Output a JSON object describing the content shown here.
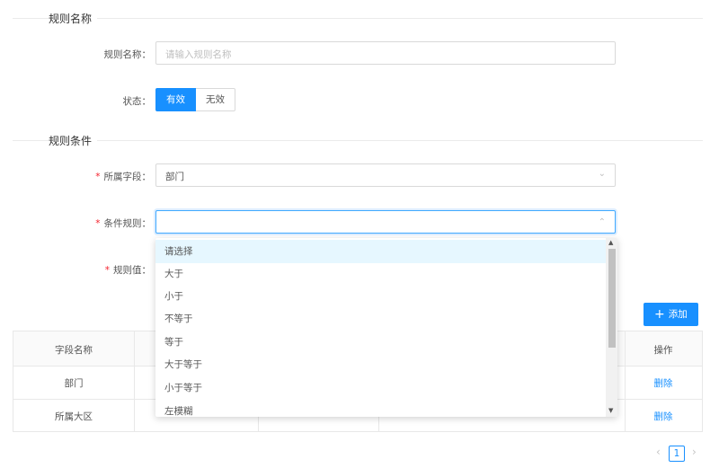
{
  "section_basic": {
    "title": "规则名称"
  },
  "rule_name": {
    "label": "规则名称：",
    "placeholder": "请输入规则名称"
  },
  "status": {
    "label": "状态：",
    "options": [
      "有效",
      "无效"
    ],
    "selected": "有效"
  },
  "section_conditions": {
    "title": "规则条件"
  },
  "field": {
    "label": "所属字段：",
    "value": "部门"
  },
  "condition_rule": {
    "label": "条件规则：",
    "value": ""
  },
  "rule_value": {
    "label": "规则值："
  },
  "add_button": {
    "label": "添加"
  },
  "table": {
    "headers": [
      "字段名称",
      "",
      "",
      "",
      "操作"
    ],
    "rows": [
      {
        "field": "部门",
        "c2": "",
        "c3": "",
        "c4": "",
        "action": "删除"
      },
      {
        "field": "所属大区",
        "c2": "",
        "c3": "",
        "c4": "",
        "action": "删除"
      }
    ]
  },
  "dropdown": {
    "options": [
      "请选择",
      "大于",
      "小于",
      "不等于",
      "等于",
      "大于等于",
      "小于等于",
      "左模糊"
    ],
    "highlighted_index": 0
  },
  "pagination": {
    "current": "1"
  },
  "colors": {
    "primary": "#1890ff",
    "required": "#f5222d",
    "highlight": "#e6f7ff"
  },
  "icons": {
    "select": "chevron-down-icon",
    "select_open": "chevron-up-icon",
    "add": "plus-icon"
  }
}
